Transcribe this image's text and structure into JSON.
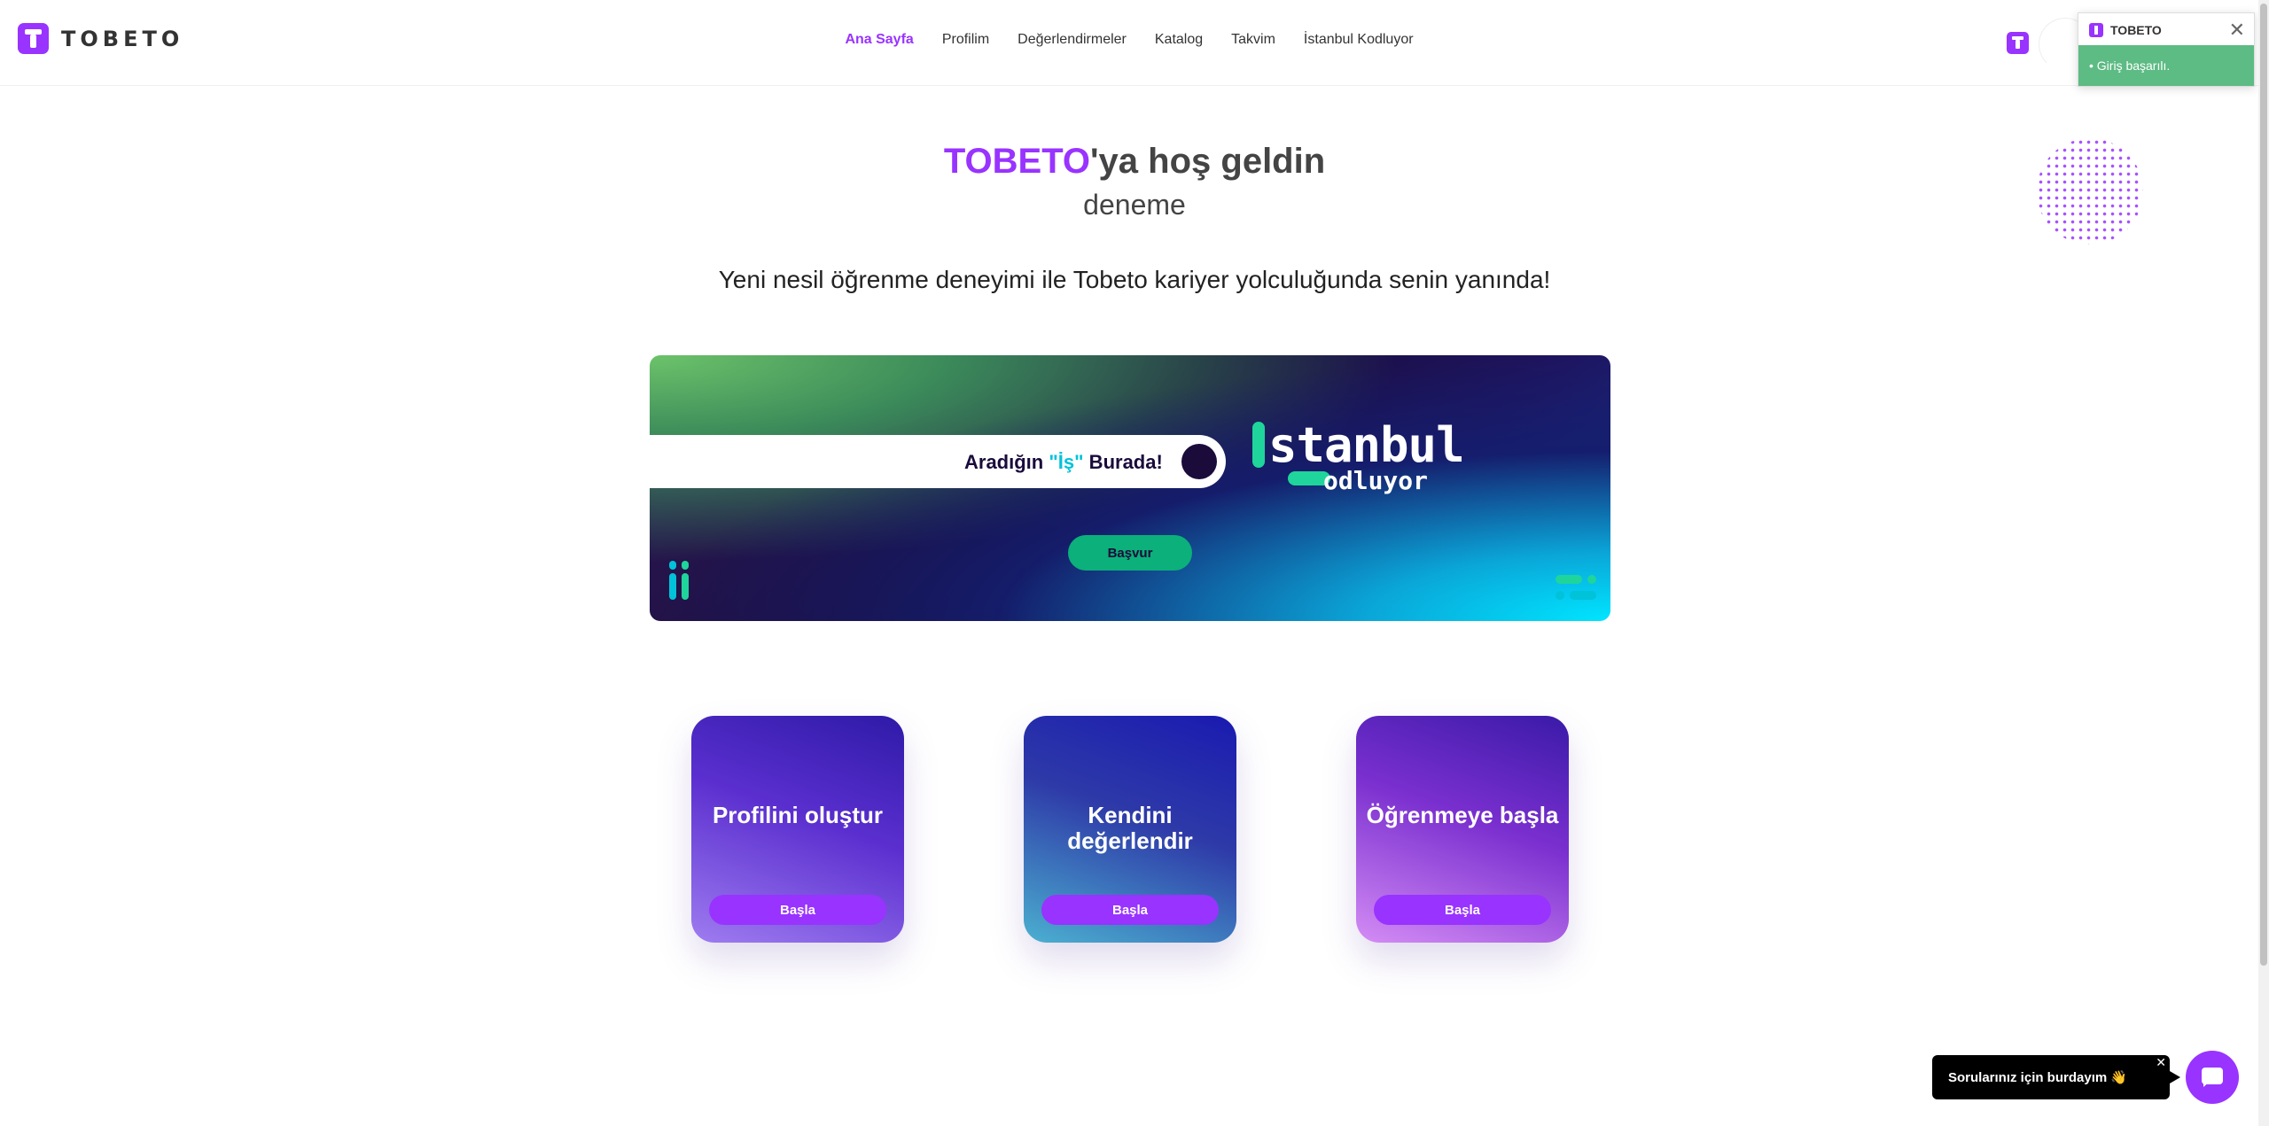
{
  "brand": {
    "name": "TOBETO"
  },
  "nav": {
    "items": [
      {
        "label": "Ana Sayfa",
        "active": true
      },
      {
        "label": "Profilim",
        "active": false
      },
      {
        "label": "Değerlendirmeler",
        "active": false
      },
      {
        "label": "Katalog",
        "active": false
      },
      {
        "label": "Takvim",
        "active": false
      },
      {
        "label": "İstanbul Kodluyor",
        "active": false
      }
    ]
  },
  "toast": {
    "title": "TOBETO",
    "message": "• Giriş başarılı."
  },
  "hero": {
    "brand_word": "TOBETO",
    "welcome_rest": "'ya hoş geldin",
    "username": "deneme",
    "tagline": "Yeni nesil öğrenme deneyimi ile Tobeto kariyer yolculuğunda senin yanında!"
  },
  "banner": {
    "search_prefix": "Aradığın ",
    "search_quote": "\"İş\"",
    "search_suffix": " Burada!",
    "logo_big": "stanbul",
    "logo_small": "odluyor",
    "apply_label": "Başvur",
    "colors": {
      "accent_green": "#1fd59b",
      "accent_cyan": "#00e5ff"
    }
  },
  "cards": [
    {
      "title": "Profilini oluştur",
      "button": "Başla"
    },
    {
      "title": "Kendini değerlendir",
      "button": "Başla"
    },
    {
      "title": "Öğrenmeye başla",
      "button": "Başla"
    }
  ],
  "chat": {
    "bubble_text": "Sorularınız için burdayım 👋",
    "close": "✕"
  },
  "colors": {
    "brand_purple": "#9933ff",
    "success_green": "#5dbb84"
  }
}
